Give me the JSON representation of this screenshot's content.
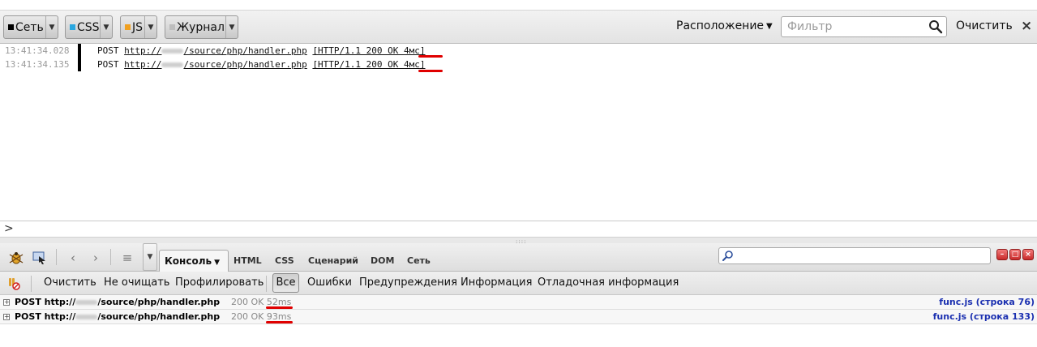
{
  "web_console": {
    "filters": [
      {
        "label": "Сеть",
        "color": "#000000"
      },
      {
        "label": "CSS",
        "color": "#2aa7e0"
      },
      {
        "label": "JS",
        "color": "#f0a020"
      },
      {
        "label": "Журнал",
        "color": "#bdbdbd"
      }
    ],
    "position_label": "Расположение",
    "filter_placeholder": "Фильтр",
    "clear_label": "Очистить",
    "entries": [
      {
        "time": "13:41:34.028",
        "method": "POST",
        "url_prefix": "http://",
        "url_suffix": "/source/php/handler.php",
        "status_prefix": "[HTTP/1.1 200 OK ",
        "duration": "4мс",
        "status_suffix": "]"
      },
      {
        "time": "13:41:34.135",
        "method": "POST",
        "url_prefix": "http://",
        "url_suffix": "/source/php/handler.php",
        "status_prefix": "[HTTP/1.1 200 OK ",
        "duration": "4мс",
        "status_suffix": "]"
      }
    ],
    "input_prompt": ">"
  },
  "firebug": {
    "tabs": [
      {
        "label": "Консоль",
        "active": true
      },
      {
        "label": "HTML"
      },
      {
        "label": "CSS"
      },
      {
        "label": "Сценарий"
      },
      {
        "label": "DOM"
      },
      {
        "label": "Сеть"
      }
    ],
    "subtoolbar": {
      "clear": "Очистить",
      "persist": "Не очищать",
      "profile": "Профилировать",
      "all": "Все",
      "errors": "Ошибки",
      "warnings": "Предупреждения",
      "info": "Информация",
      "debug": "Отладочная информация"
    },
    "rows": [
      {
        "text_prefix": "POST http://",
        "text_suffix": "/source/php/handler.php",
        "status": "200 OK ",
        "time": "52ms",
        "source": "func.js (строка 76)"
      },
      {
        "text_prefix": "POST http://",
        "text_suffix": "/source/php/handler.php",
        "status": "200 OK ",
        "time": "93ms",
        "source": "func.js (строка 133)"
      }
    ]
  },
  "colors": {
    "highlight_underline": "#e00000",
    "link_blue": "#1a2fb0"
  }
}
